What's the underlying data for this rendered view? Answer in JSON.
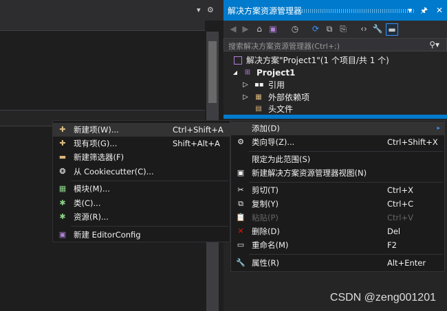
{
  "solution_explorer": {
    "title": "解决方案资源管理器",
    "title_buttons": [
      "▾",
      "🖈",
      "✕"
    ],
    "search_placeholder": "搜索解决方案资源管理器(Ctrl+;)",
    "tree": [
      {
        "label": "解决方案\"Project1\"(1 个项目/共 1 个)"
      },
      {
        "label": "Project1",
        "expander": "◢"
      },
      {
        "label": "引用",
        "expander": "▷"
      },
      {
        "label": "外部依赖项",
        "expander": "▷"
      },
      {
        "label": "头文件"
      }
    ]
  },
  "context_menu": {
    "items": [
      {
        "label": "添加(D)",
        "shortcut": "",
        "submenu_arrow": "▸"
      },
      {
        "label": "类向导(Z)...",
        "shortcut": "Ctrl+Shift+X"
      },
      {
        "label": "限定为此范围(S)",
        "shortcut": ""
      },
      {
        "label": "新建解决方案资源管理器视图(N)",
        "shortcut": ""
      },
      {
        "label": "剪切(T)",
        "shortcut": "Ctrl+X"
      },
      {
        "label": "复制(Y)",
        "shortcut": "Ctrl+C"
      },
      {
        "label": "粘贴(P)",
        "shortcut": "Ctrl+V"
      },
      {
        "label": "删除(D)",
        "shortcut": "Del"
      },
      {
        "label": "重命名(M)",
        "shortcut": "F2"
      },
      {
        "label": "属性(R)",
        "shortcut": "Alt+Enter"
      }
    ]
  },
  "add_submenu": {
    "items": [
      {
        "label": "新建项(W)...",
        "shortcut": "Ctrl+Shift+A"
      },
      {
        "label": "现有项(G)...",
        "shortcut": "Shift+Alt+A"
      },
      {
        "label": "新建筛选器(F)",
        "shortcut": ""
      },
      {
        "label": "从 Cookiecutter(C)...",
        "shortcut": ""
      },
      {
        "label": "模块(M)...",
        "shortcut": ""
      },
      {
        "label": "类(C)...",
        "shortcut": ""
      },
      {
        "label": "资源(R)...",
        "shortcut": ""
      },
      {
        "label": "新建 EditorConfig",
        "shortcut": ""
      }
    ]
  },
  "top_left_icons": {
    "dropdown": "▾",
    "gear": "⚙"
  },
  "watermark": "CSDN @zeng001201",
  "colors": {
    "accent": "#007acc",
    "menu_bg": "#1b1b1c",
    "highlight": "#333334",
    "delete_red": "#e51400"
  }
}
